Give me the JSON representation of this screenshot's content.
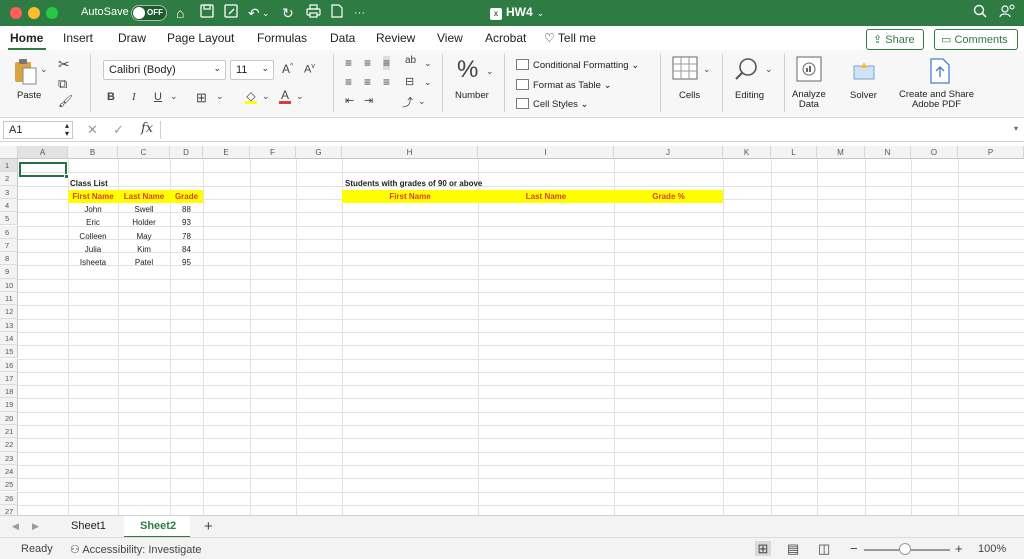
{
  "titlebar": {
    "autosave_label": "AutoSave",
    "autosave_state": "OFF",
    "doc_title": "HW4",
    "more_glyph": "···"
  },
  "tabs": [
    "Home",
    "Insert",
    "Draw",
    "Page Layout",
    "Formulas",
    "Data",
    "Review",
    "View",
    "Acrobat"
  ],
  "tell_me": "Tell me",
  "share_label": "Share",
  "comments_label": "Comments",
  "ribbon": {
    "paste_label": "Paste",
    "font_name": "Calibri (Body)",
    "font_size": "11",
    "number_label": "Number",
    "conditional_formatting": "Conditional Formatting",
    "format_as_table": "Format as Table",
    "cell_styles": "Cell Styles",
    "cells_label": "Cells",
    "editing_label": "Editing",
    "analyze_data_line1": "Analyze",
    "analyze_data_line2": "Data",
    "solver_label": "Solver",
    "pdf_line1": "Create and Share",
    "pdf_line2": "Adobe PDF"
  },
  "formula_bar": {
    "name_box": "A1",
    "fx": "fx",
    "content": ""
  },
  "columns": [
    "A",
    "B",
    "C",
    "D",
    "E",
    "F",
    "G",
    "H",
    "I",
    "J",
    "K",
    "L",
    "M",
    "N",
    "O",
    "P"
  ],
  "rows": [
    "1",
    "2",
    "3",
    "4",
    "5",
    "6",
    "7",
    "8",
    "9",
    "10",
    "11",
    "12",
    "13",
    "14",
    "15",
    "16",
    "17",
    "18",
    "19",
    "20",
    "21",
    "22",
    "23",
    "24",
    "25",
    "26",
    "27"
  ],
  "class_list": {
    "title": "Class List",
    "headers": [
      "First Name",
      "Last Name",
      "Grade"
    ],
    "rows": [
      [
        "John",
        "Swell",
        "88"
      ],
      [
        "Eric",
        "Holder",
        "93"
      ],
      [
        "Colleen",
        "May",
        "78"
      ],
      [
        "Julia",
        "Kim",
        "84"
      ],
      [
        "Isheeta",
        "Patel",
        "95"
      ]
    ]
  },
  "students_90": {
    "title": "Students with grades of 90 or above",
    "headers": [
      "First Name",
      "Last Name",
      "Grade %"
    ]
  },
  "sheets": [
    "Sheet1",
    "Sheet2"
  ],
  "active_sheet": "Sheet2",
  "status": {
    "ready": "Ready",
    "accessibility": "Accessibility: Investigate",
    "zoom": "100%"
  },
  "colors": {
    "excel_green": "#2e7c44",
    "highlight_yellow": "#ffff00",
    "header_red": "#e03a3a"
  },
  "icons": [
    "home-icon",
    "save-icon",
    "undo-icon",
    "redo-icon",
    "print-icon",
    "search-icon",
    "account-icon",
    "lightbulb-icon"
  ]
}
